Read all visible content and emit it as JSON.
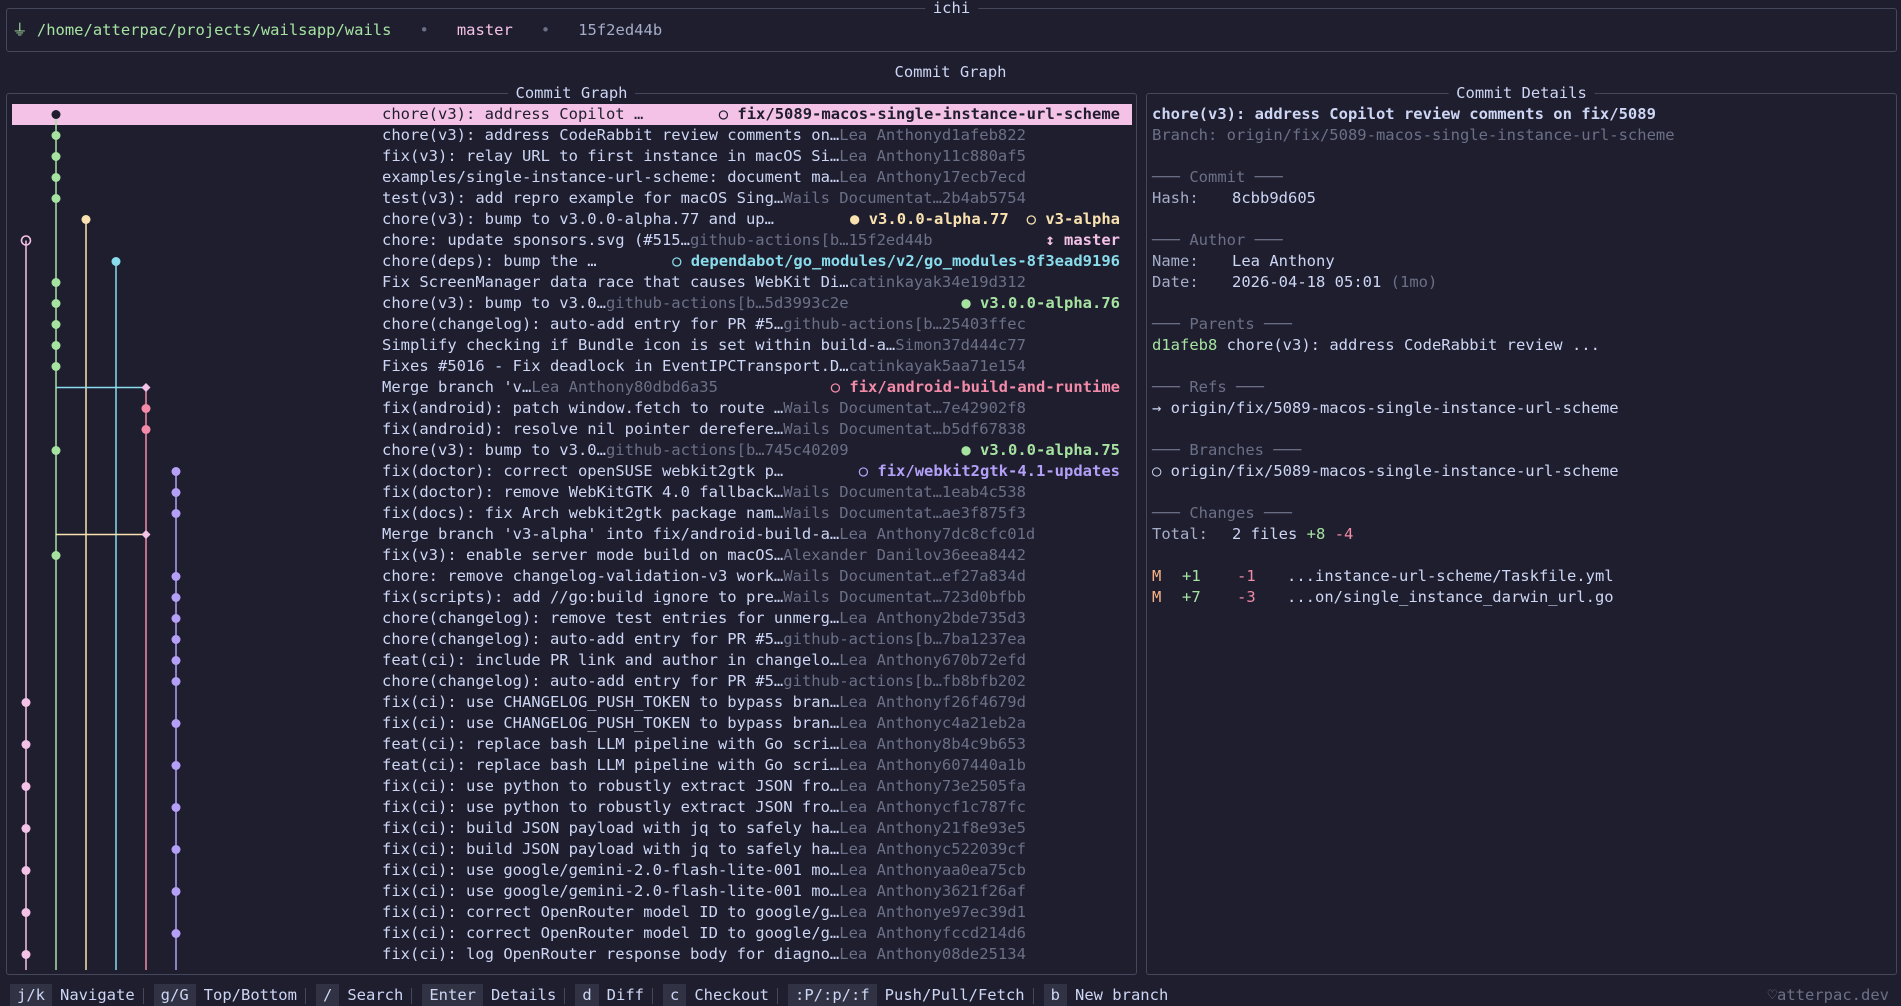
{
  "window": {
    "title": "ichi"
  },
  "header": {
    "path_icon": "plug-icon",
    "path": "/home/atterpac/projects/wailsapp/wails",
    "branch": "master",
    "hash": "15f2ed44b"
  },
  "view_title": "Commit Graph",
  "graph_panel": {
    "title": "Commit Graph"
  },
  "commits": [
    {
      "message": "chore(v3): address Copilot …",
      "author": "",
      "hash": "",
      "refs": [
        {
          "text": "○ fix/5089-macos-single-instance-url-scheme",
          "color": "#1e1e2e"
        }
      ],
      "selected": true
    },
    {
      "message": "chore(v3): address CodeRabbit review comments on…",
      "author": "Lea Anthony",
      "hash": "d1afeb822",
      "refs": []
    },
    {
      "message": "fix(v3): relay URL to first instance in macOS Si…",
      "author": "Lea Anthony",
      "hash": "11c880af5",
      "refs": []
    },
    {
      "message": "examples/single-instance-url-scheme: document ma…",
      "author": "Lea Anthony",
      "hash": "17ecb7ecd",
      "refs": []
    },
    {
      "message": "test(v3): add repro example for macOS Sing…",
      "author": "Wails Documentat…",
      "hash": "2b4ab5754",
      "refs": []
    },
    {
      "message": "chore(v3): bump to v3.0.0-alpha.77 and up…",
      "author": "",
      "hash": "",
      "refs": [
        {
          "text": "● v3.0.0-alpha.77",
          "color": "#f9e2af"
        },
        {
          "text": "○ v3-alpha",
          "color": "#f9e2af"
        }
      ]
    },
    {
      "message": "chore: update sponsors.svg (#515…",
      "author": "github-actions[b…",
      "hash": "15f2ed44b",
      "refs": [
        {
          "text": "↕ master",
          "color": "#f5c2e7"
        }
      ]
    },
    {
      "message": "chore(deps): bump the …",
      "author": "",
      "hash": "",
      "refs": [
        {
          "text": "○ dependabot/go_modules/v2/go_modules-8f3ead9196",
          "color": "#89dceb"
        }
      ]
    },
    {
      "message": "Fix ScreenManager data race that causes WebKit Di…",
      "author": "catinkayak",
      "hash": "34e19d312",
      "refs": []
    },
    {
      "message": "chore(v3): bump to v3.0…",
      "author": "github-actions[b…",
      "hash": "5d3993c2e",
      "refs": [
        {
          "text": "● v3.0.0-alpha.76",
          "color": "#a6e3a1"
        }
      ]
    },
    {
      "message": "chore(changelog): auto-add entry for PR #5…",
      "author": "github-actions[b…",
      "hash": "25403ffec",
      "refs": []
    },
    {
      "message": "Simplify checking if Bundle icon is set within build-a…",
      "author": "Simon",
      "hash": "37d444c77",
      "refs": []
    },
    {
      "message": "Fixes #5016 - Fix deadlock in EventIPCTransport.D…",
      "author": "catinkayak",
      "hash": "5aa71e154",
      "refs": []
    },
    {
      "message": "Merge branch 'v…",
      "author": "Lea Anthony",
      "hash": "80dbd6a35",
      "refs": [
        {
          "text": "○ fix/android-build-and-runtime",
          "color": "#f38ba8"
        }
      ]
    },
    {
      "message": "fix(android): patch window.fetch to route …",
      "author": "Wails Documentat…",
      "hash": "7e42902f8",
      "refs": []
    },
    {
      "message": "fix(android): resolve nil pointer derefere…",
      "author": "Wails Documentat…",
      "hash": "b5df67838",
      "refs": []
    },
    {
      "message": "chore(v3): bump to v3.0…",
      "author": "github-actions[b…",
      "hash": "745c40209",
      "refs": [
        {
          "text": "● v3.0.0-alpha.75",
          "color": "#a6e3a1"
        }
      ]
    },
    {
      "message": "fix(doctor): correct openSUSE webkit2gtk p…",
      "author": "",
      "hash": "",
      "refs": [
        {
          "text": "○ fix/webkit2gtk-4.1-updates",
          "color": "#b4a0f8"
        }
      ]
    },
    {
      "message": "fix(doctor): remove WebKitGTK 4.0 fallback…",
      "author": "Wails Documentat…",
      "hash": "1eab4c538",
      "refs": []
    },
    {
      "message": "fix(docs): fix Arch webkit2gtk package nam…",
      "author": "Wails Documentat…",
      "hash": "ae3f875f3",
      "refs": []
    },
    {
      "message": "Merge branch 'v3-alpha' into fix/android-build-a…",
      "author": "Lea Anthony",
      "hash": "7dc8cfc01d",
      "refs": []
    },
    {
      "message": "fix(v3): enable server mode build on macOS…",
      "author": "Alexander Danilov",
      "hash": "36eea8442",
      "refs": []
    },
    {
      "message": "chore: remove changelog-validation-v3 work…",
      "author": "Wails Documentat…",
      "hash": "ef27a834d",
      "refs": []
    },
    {
      "message": "fix(scripts): add //go:build ignore to pre…",
      "author": "Wails Documentat…",
      "hash": "723d0bfbb",
      "refs": []
    },
    {
      "message": "chore(changelog): remove test entries for unmerg…",
      "author": "Lea Anthony",
      "hash": "2bde735d3",
      "refs": []
    },
    {
      "message": "chore(changelog): auto-add entry for PR #5…",
      "author": "github-actions[b…",
      "hash": "7ba1237ea",
      "refs": []
    },
    {
      "message": "feat(ci): include PR link and author in changelo…",
      "author": "Lea Anthony",
      "hash": "670b72efd",
      "refs": []
    },
    {
      "message": "chore(changelog): auto-add entry for PR #5…",
      "author": "github-actions[b…",
      "hash": "fb8bfb202",
      "refs": []
    },
    {
      "message": "fix(ci): use CHANGELOG_PUSH_TOKEN to bypass bran…",
      "author": "Lea Anthony",
      "hash": "f26f4679d",
      "refs": []
    },
    {
      "message": "fix(ci): use CHANGELOG_PUSH_TOKEN to bypass bran…",
      "author": "Lea Anthony",
      "hash": "c4a21eb2a",
      "refs": []
    },
    {
      "message": "feat(ci): replace bash LLM pipeline with Go scri…",
      "author": "Lea Anthony",
      "hash": "8b4c9b653",
      "refs": []
    },
    {
      "message": "feat(ci): replace bash LLM pipeline with Go scri…",
      "author": "Lea Anthony",
      "hash": "607440a1b",
      "refs": []
    },
    {
      "message": "fix(ci): use python to robustly extract JSON fro…",
      "author": "Lea Anthony",
      "hash": "73e2505fa",
      "refs": []
    },
    {
      "message": "fix(ci): use python to robustly extract JSON fro…",
      "author": "Lea Anthony",
      "hash": "cf1c787fc",
      "refs": []
    },
    {
      "message": "fix(ci): build JSON payload with jq to safely ha…",
      "author": "Lea Anthony",
      "hash": "21f8e93e5",
      "refs": []
    },
    {
      "message": "fix(ci): build JSON payload with jq to safely ha…",
      "author": "Lea Anthony",
      "hash": "c522039cf",
      "refs": []
    },
    {
      "message": "fix(ci): use google/gemini-2.0-flash-lite-001 mo…",
      "author": "Lea Anthony",
      "hash": "aa0ea75cb",
      "refs": []
    },
    {
      "message": "fix(ci): use google/gemini-2.0-flash-lite-001 mo…",
      "author": "Lea Anthony",
      "hash": "3621f26af",
      "refs": []
    },
    {
      "message": "fix(ci): correct OpenRouter model ID to google/g…",
      "author": "Lea Anthony",
      "hash": "e97ec39d1",
      "refs": []
    },
    {
      "message": "fix(ci): correct OpenRouter model ID to google/g…",
      "author": "Lea Anthony",
      "hash": "fccd214d6",
      "refs": []
    },
    {
      "message": "fix(ci): log OpenRouter response body for diagno…",
      "author": "Lea Anthony",
      "hash": "08de25134",
      "refs": []
    }
  ],
  "graph_colors": {
    "selected": "#1e1e2e",
    "green": "#a6e3a1",
    "yellow": "#f9e2af",
    "pink": "#f5c2e7",
    "teal": "#89dceb",
    "red": "#f38ba8",
    "purple": "#b4a0f8"
  },
  "details": {
    "title": "Commit Details",
    "subject": "chore(v3): address Copilot review comments on fix/5089",
    "branch_line": "Branch: origin/fix/5089-macos-single-instance-url-scheme",
    "commit_head": "─── Commit ───",
    "hash_label": "Hash:",
    "hash": "8cbb9d605",
    "author_head": "─── Author ───",
    "name_label": "Name:",
    "name": "Lea Anthony",
    "date_label": "Date:",
    "date": "2026-04-18 05:01",
    "date_rel": "(1mo)",
    "parents_head": "─── Parents ───",
    "parent_hash": "d1afeb8",
    "parent_msg": "chore(v3): address CodeRabbit review  ...",
    "refs_head": "─── Refs ───",
    "ref": "→ origin/fix/5089-macos-single-instance-url-scheme",
    "branches_head": "─── Branches ───",
    "branch": "○ origin/fix/5089-macos-single-instance-url-scheme",
    "changes_head": "─── Changes ───",
    "total_label": "Total:",
    "total_files": "2 files",
    "total_add": "+8",
    "total_del": "-4",
    "files": [
      {
        "status": "M",
        "add": "+1",
        "del": "-1",
        "path": "...instance-url-scheme/Taskfile.yml"
      },
      {
        "status": "M",
        "add": "+7",
        "del": "-3",
        "path": "...on/single_instance_darwin_url.go"
      }
    ]
  },
  "footer": {
    "keys": [
      {
        "key": "j/k",
        "label": "Navigate"
      },
      {
        "key": "g/G",
        "label": "Top/Bottom"
      },
      {
        "key": "/",
        "label": "Search"
      },
      {
        "key": "Enter",
        "label": "Details"
      },
      {
        "key": "d",
        "label": "Diff"
      },
      {
        "key": "c",
        "label": "Checkout"
      },
      {
        "key": ":P/:p/:f",
        "label": "Push/Pull/Fetch"
      },
      {
        "key": "b",
        "label": "New branch"
      }
    ],
    "credit": "♡atterpac.dev"
  }
}
